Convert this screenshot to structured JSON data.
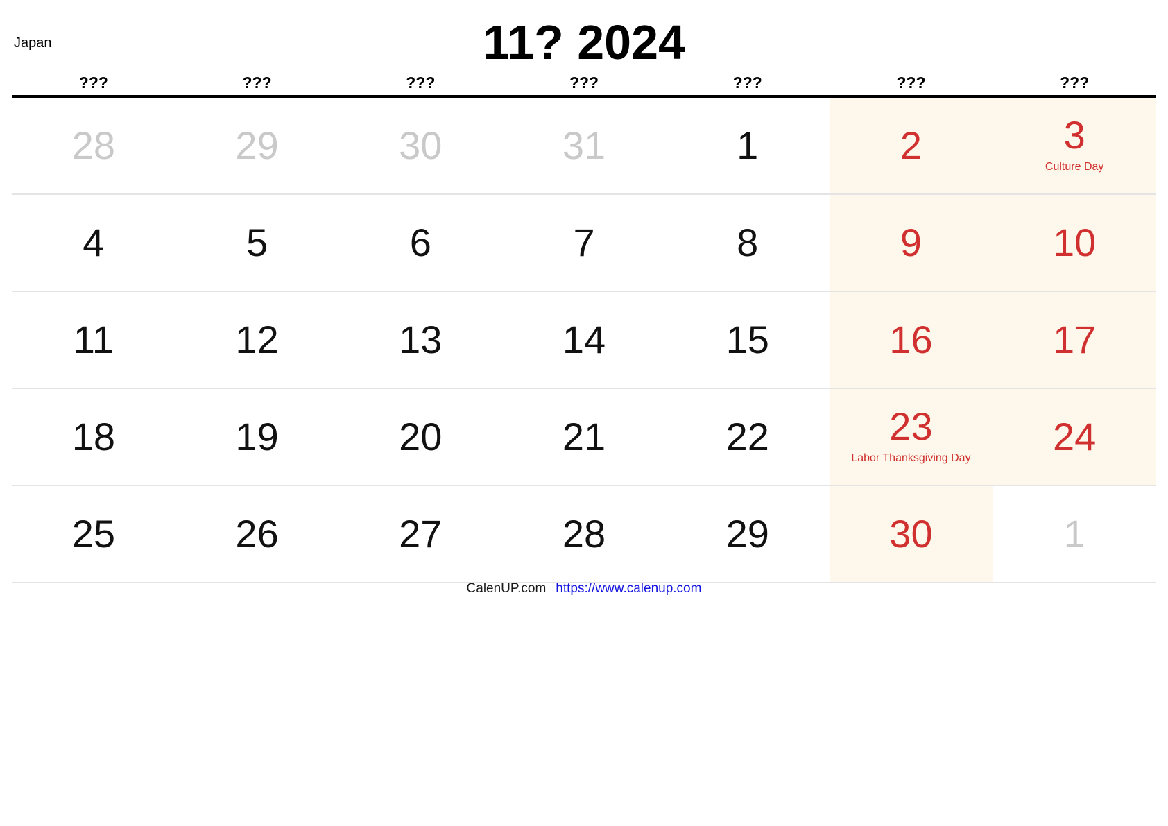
{
  "header": {
    "country": "Japan",
    "title": "11? 2024"
  },
  "weekdays": [
    {
      "label": "???"
    },
    {
      "label": "???"
    },
    {
      "label": "???"
    },
    {
      "label": "???"
    },
    {
      "label": "???"
    },
    {
      "label": "???"
    },
    {
      "label": "???"
    }
  ],
  "colors": {
    "weekend_background": "#fdf8eb",
    "holiday_red": "#d0302f",
    "muted_gray": "#c9c9c9",
    "link_blue": "#1414e0",
    "header_rule": "#000000",
    "row_separator": "#e4e4e4"
  },
  "weeks": [
    {
      "days": [
        {
          "number": "28",
          "style": "muted",
          "weekend_bg": false,
          "holiday": ""
        },
        {
          "number": "29",
          "style": "muted",
          "weekend_bg": false,
          "holiday": ""
        },
        {
          "number": "30",
          "style": "muted",
          "weekend_bg": false,
          "holiday": ""
        },
        {
          "number": "31",
          "style": "muted",
          "weekend_bg": false,
          "holiday": ""
        },
        {
          "number": "1",
          "style": "normal",
          "weekend_bg": false,
          "holiday": ""
        },
        {
          "number": "2",
          "style": "red",
          "weekend_bg": true,
          "holiday": ""
        },
        {
          "number": "3",
          "style": "red",
          "weekend_bg": true,
          "holiday": "Culture Day"
        }
      ]
    },
    {
      "days": [
        {
          "number": "4",
          "style": "normal",
          "weekend_bg": false,
          "holiday": ""
        },
        {
          "number": "5",
          "style": "normal",
          "weekend_bg": false,
          "holiday": ""
        },
        {
          "number": "6",
          "style": "normal",
          "weekend_bg": false,
          "holiday": ""
        },
        {
          "number": "7",
          "style": "normal",
          "weekend_bg": false,
          "holiday": ""
        },
        {
          "number": "8",
          "style": "normal",
          "weekend_bg": false,
          "holiday": ""
        },
        {
          "number": "9",
          "style": "red",
          "weekend_bg": true,
          "holiday": ""
        },
        {
          "number": "10",
          "style": "red",
          "weekend_bg": true,
          "holiday": ""
        }
      ]
    },
    {
      "days": [
        {
          "number": "11",
          "style": "normal",
          "weekend_bg": false,
          "holiday": ""
        },
        {
          "number": "12",
          "style": "normal",
          "weekend_bg": false,
          "holiday": ""
        },
        {
          "number": "13",
          "style": "normal",
          "weekend_bg": false,
          "holiday": ""
        },
        {
          "number": "14",
          "style": "normal",
          "weekend_bg": false,
          "holiday": ""
        },
        {
          "number": "15",
          "style": "normal",
          "weekend_bg": false,
          "holiday": ""
        },
        {
          "number": "16",
          "style": "red",
          "weekend_bg": true,
          "holiday": ""
        },
        {
          "number": "17",
          "style": "red",
          "weekend_bg": true,
          "holiday": ""
        }
      ]
    },
    {
      "days": [
        {
          "number": "18",
          "style": "normal",
          "weekend_bg": false,
          "holiday": ""
        },
        {
          "number": "19",
          "style": "normal",
          "weekend_bg": false,
          "holiday": ""
        },
        {
          "number": "20",
          "style": "normal",
          "weekend_bg": false,
          "holiday": ""
        },
        {
          "number": "21",
          "style": "normal",
          "weekend_bg": false,
          "holiday": ""
        },
        {
          "number": "22",
          "style": "normal",
          "weekend_bg": false,
          "holiday": ""
        },
        {
          "number": "23",
          "style": "red",
          "weekend_bg": true,
          "holiday": "Labor Thanksgiving Day"
        },
        {
          "number": "24",
          "style": "red",
          "weekend_bg": true,
          "holiday": ""
        }
      ]
    },
    {
      "days": [
        {
          "number": "25",
          "style": "normal",
          "weekend_bg": false,
          "holiday": ""
        },
        {
          "number": "26",
          "style": "normal",
          "weekend_bg": false,
          "holiday": ""
        },
        {
          "number": "27",
          "style": "normal",
          "weekend_bg": false,
          "holiday": ""
        },
        {
          "number": "28",
          "style": "normal",
          "weekend_bg": false,
          "holiday": ""
        },
        {
          "number": "29",
          "style": "normal",
          "weekend_bg": false,
          "holiday": ""
        },
        {
          "number": "30",
          "style": "red",
          "weekend_bg": true,
          "holiday": ""
        },
        {
          "number": "1",
          "style": "muted",
          "weekend_bg": false,
          "holiday": ""
        }
      ]
    }
  ],
  "footer": {
    "brand": "CalenUP.com",
    "url": "https://www.calenup.com"
  }
}
